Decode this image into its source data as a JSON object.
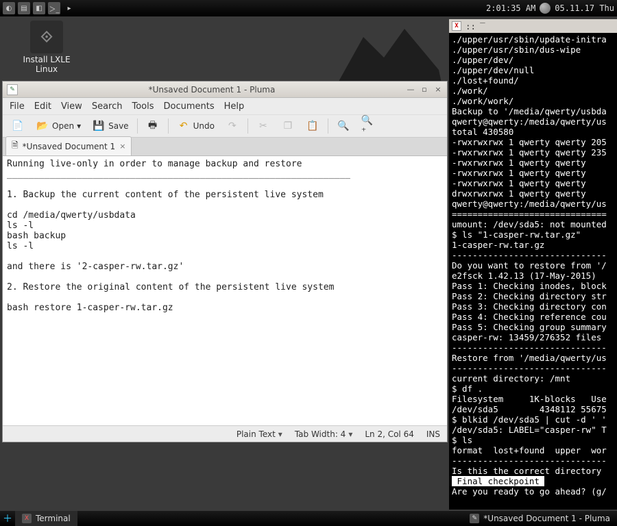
{
  "panel": {
    "time": "2:01:35 AM",
    "date": "05.11.17 Thu"
  },
  "desktop": {
    "install_label_1": "Install LXLE",
    "install_label_2": "Linux"
  },
  "pluma": {
    "title": "*Unsaved Document 1 - Pluma",
    "menu": {
      "file": "File",
      "edit": "Edit",
      "view": "View",
      "search": "Search",
      "tools": "Tools",
      "documents": "Documents",
      "help": "Help"
    },
    "toolbar": {
      "open": "Open",
      "save": "Save",
      "undo": "Undo"
    },
    "tab_label": "*Unsaved Document 1",
    "content": "Running live-only in order to manage backup and restore\n________________________________________________________________\n\n1. Backup the current content of the persistent live system\n\ncd /media/qwerty/usbdata\nls -l\nbash backup\nls -l\n\nand there is '2-casper-rw.tar.gz'\n\n2. Restore the original content of the persistent live system\n\nbash restore 1-casper-rw.tar.gz",
    "status": {
      "syntax": "Plain Text",
      "tabwidth": "Tab Width: 4",
      "pos": "Ln 2, Col 64",
      "ins": "INS"
    }
  },
  "terminal": {
    "title_dots": "::",
    "lines_before": "./upper/usr/sbin/update-initra\n./upper/usr/sbin/dus-wipe\n./upper/dev/\n./upper/dev/null\n./lost+found/\n./work/\n./work/work/\nBackup to '/media/qwerty/usbda\nqwerty@qwerty:/media/qwerty/us\ntotal 430580\n-rwxrwxrwx 1 qwerty qwerty 205\n-rwxrwxrwx 1 qwerty qwerty 235\n-rwxrwxrwx 1 qwerty qwerty    \n-rwxrwxrwx 1 qwerty qwerty    \n-rwxrwxrwx 1 qwerty qwerty    \ndrwxrwxrwx 1 qwerty qwerty    \nqwerty@qwerty:/media/qwerty/us\n==============================\numount: /dev/sda5: not mounted\n$ ls \"1-casper-rw.tar.gz\"\n1-casper-rw.tar.gz\n------------------------------\nDo you want to restore from '/\ne2fsck 1.42.13 (17-May-2015)\nPass 1: Checking inodes, block\nPass 2: Checking directory str\nPass 3: Checking directory con\nPass 4: Checking reference cou\nPass 5: Checking group summary\ncasper-rw: 13459/276352 files \n------------------------------\nRestore from '/media/qwerty/us\n------------------------------\ncurrent directory: /mnt\n$ df .\nFilesystem     1K-blocks   Use\n/dev/sda5        4348112 55675\n$ blkid /dev/sda5 | cut -d ' '\n/dev/sda5: LABEL=\"casper-rw\" T\n$ ls\nformat  lost+found  upper  wor\n------------------------------\nIs this the correct directory ",
    "highlight": " Final checkpoint ",
    "lines_after": "Are you ready to go ahead? (g/"
  },
  "bottom": {
    "task1": "Terminal",
    "task2": "*Unsaved Document 1 - Pluma"
  }
}
